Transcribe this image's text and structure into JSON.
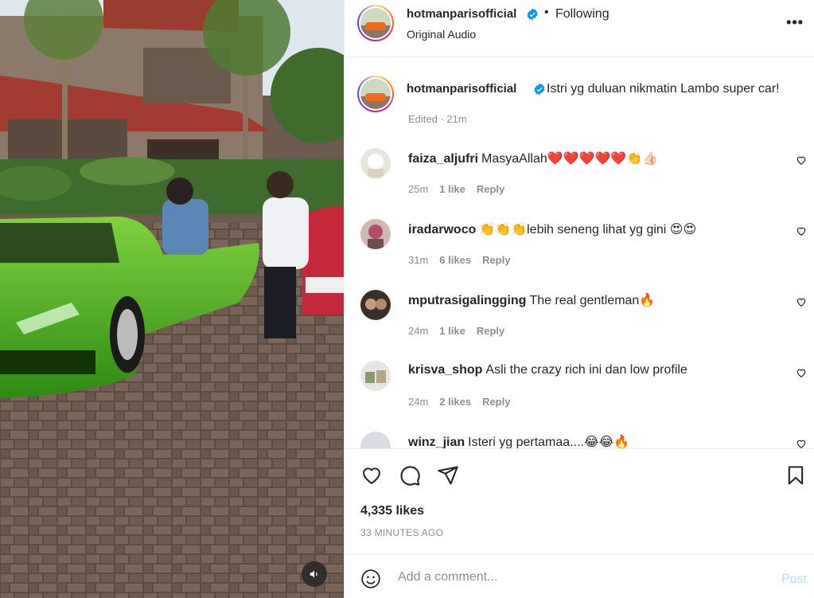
{
  "post": {
    "username": "hotmanparisofficial",
    "separator": "•",
    "follow_label": "Following",
    "audio_label": "Original Audio",
    "more_label": "•••"
  },
  "caption": {
    "username": "hotmanparisofficial",
    "text": "Istri yg duluan nikmatin Lambo super car!",
    "meta": "Edited · 21m"
  },
  "comments": [
    {
      "username": "faiza_aljufri",
      "text": "MasyaAllah❤️❤️❤️❤️❤️👏👍🏻",
      "time": "25m",
      "likes": "1 like",
      "reply": "Reply"
    },
    {
      "username": "iradarwoco",
      "text": "👏👏👏lebih seneng lihat yg gini 😍😍",
      "time": "31m",
      "likes": "6 likes",
      "reply": "Reply"
    },
    {
      "username": "mputrasigalingging",
      "text": "The real gentleman🔥",
      "time": "24m",
      "likes": "1 like",
      "reply": "Reply"
    },
    {
      "username": "krisva_shop",
      "text": "Asli the crazy rich ini dan low profile",
      "time": "24m",
      "likes": "2 likes",
      "reply": "Reply"
    },
    {
      "username": "winz_jian",
      "text": "Isteri yg pertamaa....😂😂🔥",
      "time": "",
      "likes": "",
      "reply": ""
    }
  ],
  "stats": {
    "likes": "4,335 likes",
    "time": "33 MINUTES AGO"
  },
  "composer": {
    "placeholder": "Add a comment...",
    "post_label": "Post"
  },
  "icons": {
    "verified": "verified-badge-icon",
    "like": "heart-icon",
    "comment": "comment-icon",
    "share": "share-icon",
    "save": "bookmark-icon",
    "emoji": "emoji-icon",
    "mute": "speaker-icon",
    "more": "more-icon"
  },
  "colors": {
    "verified_blue": "#0095f6",
    "muted_text": "#8e8e8e",
    "post_disabled": "#b2dffc",
    "car_green": "#4caf2a"
  }
}
